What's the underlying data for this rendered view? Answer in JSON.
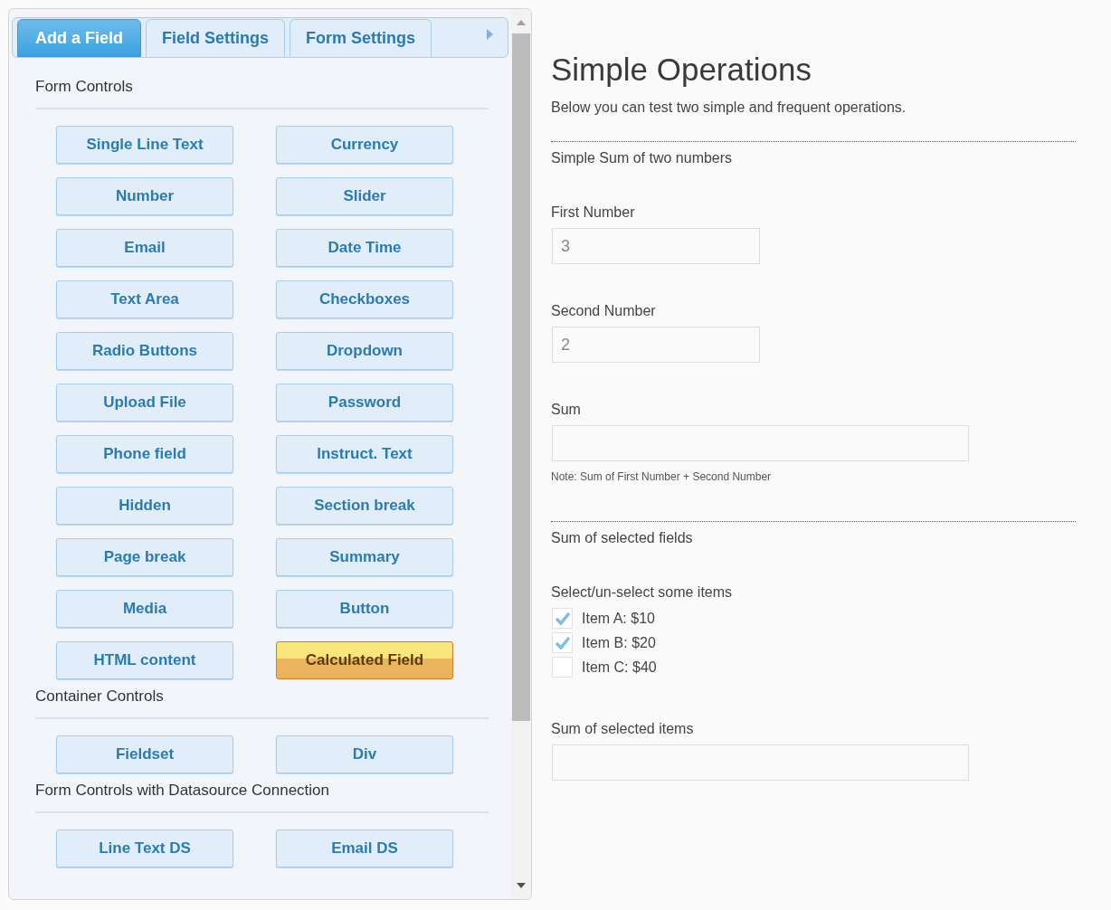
{
  "tabs": [
    {
      "label": "Add a Field",
      "selected": true
    },
    {
      "label": "Field Settings",
      "selected": false
    },
    {
      "label": "Form Settings",
      "selected": false
    }
  ],
  "sections": [
    {
      "title": "Form Controls",
      "buttons": [
        {
          "label": "Single Line Text",
          "kind": "normal"
        },
        {
          "label": "Currency",
          "kind": "normal"
        },
        {
          "label": "Number",
          "kind": "normal"
        },
        {
          "label": "Slider",
          "kind": "normal"
        },
        {
          "label": "Email",
          "kind": "normal"
        },
        {
          "label": "Date Time",
          "kind": "normal"
        },
        {
          "label": "Text Area",
          "kind": "normal"
        },
        {
          "label": "Checkboxes",
          "kind": "normal"
        },
        {
          "label": "Radio Buttons",
          "kind": "normal"
        },
        {
          "label": "Dropdown",
          "kind": "normal"
        },
        {
          "label": "Upload File",
          "kind": "normal"
        },
        {
          "label": "Password",
          "kind": "normal"
        },
        {
          "label": "Phone field",
          "kind": "normal"
        },
        {
          "label": "Instruct. Text",
          "kind": "normal"
        },
        {
          "label": "Hidden",
          "kind": "normal"
        },
        {
          "label": "Section break",
          "kind": "normal"
        },
        {
          "label": "Page break",
          "kind": "normal"
        },
        {
          "label": "Summary",
          "kind": "normal"
        },
        {
          "label": "Media",
          "kind": "normal"
        },
        {
          "label": "Button",
          "kind": "normal"
        },
        {
          "label": "HTML content",
          "kind": "normal"
        },
        {
          "label": "Calculated Field",
          "kind": "highlight"
        }
      ]
    },
    {
      "title": "Container Controls",
      "buttons": [
        {
          "label": "Fieldset",
          "kind": "normal"
        },
        {
          "label": "Div",
          "kind": "normal"
        }
      ]
    },
    {
      "title": "Form Controls with Datasource Connection",
      "buttons": [
        {
          "label": "Line Text DS",
          "kind": "normal"
        },
        {
          "label": "Email DS",
          "kind": "normal"
        }
      ]
    }
  ],
  "form": {
    "title": "Simple Operations",
    "description": "Below you can test two simple and frequent operations.",
    "sections": [
      {
        "title": "Simple Sum of two numbers",
        "fields": [
          {
            "kind": "short",
            "label": "First Number",
            "value": "3"
          },
          {
            "kind": "short",
            "label": "Second Number",
            "value": "2"
          },
          {
            "kind": "wide",
            "label": "Sum",
            "note": "Note: Sum of First Number + Second Number"
          }
        ]
      },
      {
        "title": "Sum of selected fields",
        "fields": [
          {
            "kind": "checkboxes",
            "label": "Select/un-select some items",
            "options": [
              {
                "label": "Item A: $10",
                "checked": true
              },
              {
                "label": "Item B: $20",
                "checked": true
              },
              {
                "label": "Item C: $40",
                "checked": false
              }
            ]
          },
          {
            "kind": "wide",
            "label": "Sum of selected items"
          }
        ]
      }
    ]
  }
}
